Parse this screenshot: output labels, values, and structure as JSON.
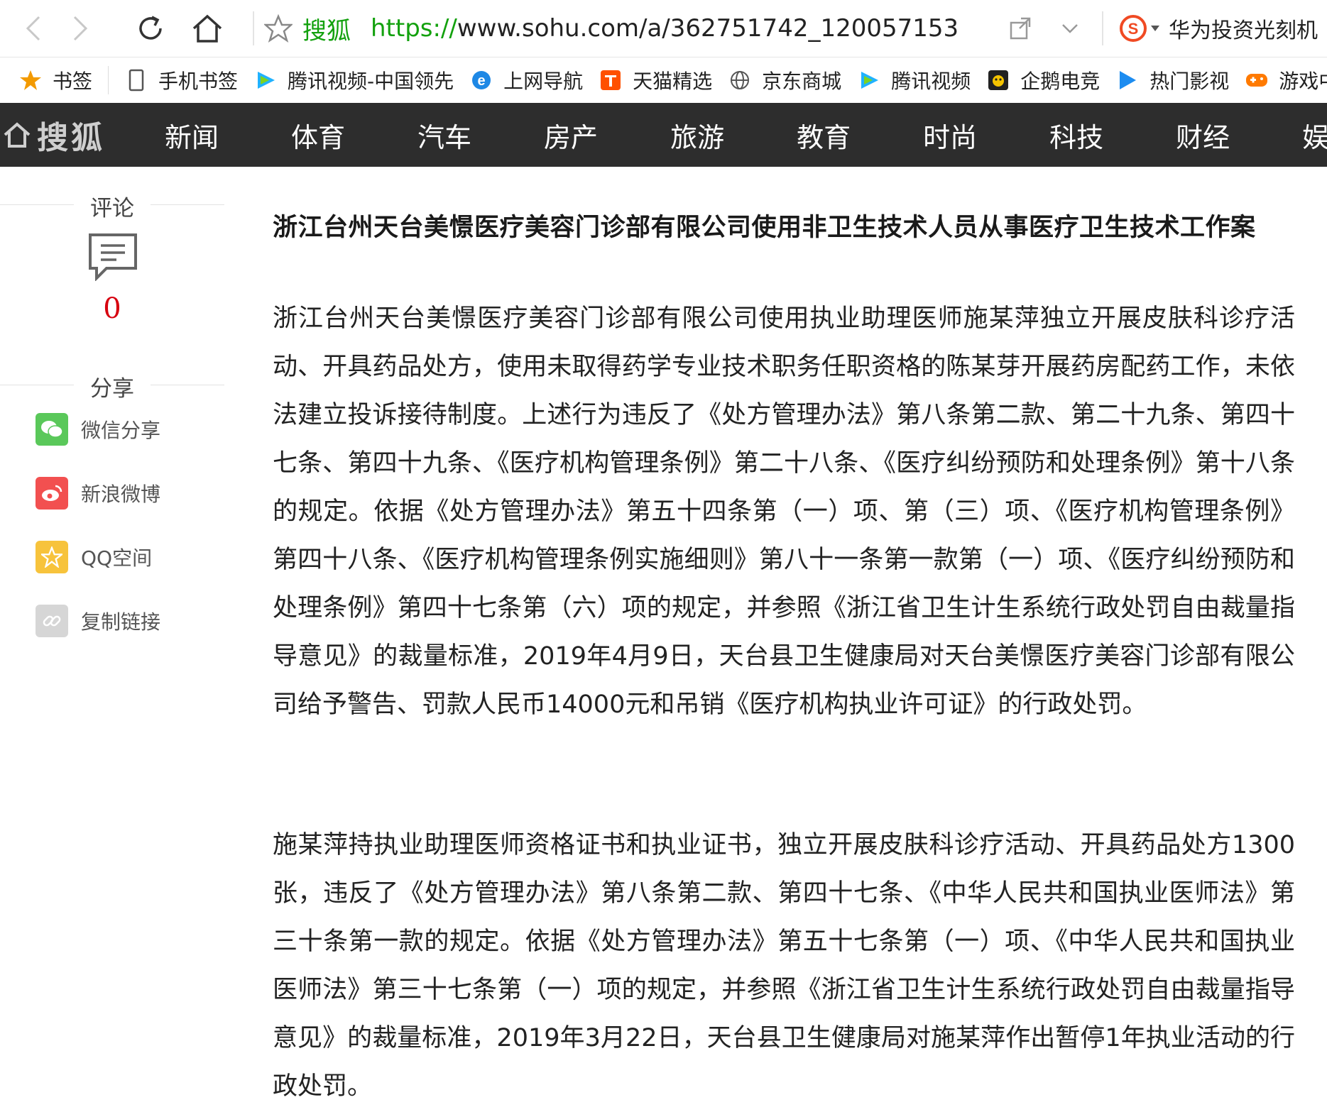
{
  "browser": {
    "address": {
      "site_label": "搜狐",
      "url_protocol": "https://",
      "url_rest": "www.sohu.com/a/362751742_120057153"
    },
    "search_text": "华为投资光刻机"
  },
  "bookmarks": [
    {
      "label": "书签",
      "icon": "star-icon"
    },
    {
      "label": "手机书签",
      "icon": "phone-icon"
    },
    {
      "label": "腾讯视频-中国领先",
      "icon": "tencent-video-icon"
    },
    {
      "label": "上网导航",
      "icon": "ie-icon"
    },
    {
      "label": "天猫精选",
      "icon": "tmall-icon"
    },
    {
      "label": "京东商城",
      "icon": "globe-icon"
    },
    {
      "label": "腾讯视频",
      "icon": "tencent-video-icon"
    },
    {
      "label": "企鹅电竞",
      "icon": "penguin-icon"
    },
    {
      "label": "热门影视",
      "icon": "play-icon"
    },
    {
      "label": "游戏中",
      "icon": "gamepad-icon"
    }
  ],
  "channel_nav": {
    "logo": "搜狐",
    "items": [
      "新闻",
      "体育",
      "汽车",
      "房产",
      "旅游",
      "教育",
      "时尚",
      "科技",
      "财经",
      "娱"
    ]
  },
  "sidebar": {
    "comment_label": "评论",
    "comment_count": "0",
    "share_label": "分享",
    "share_items": [
      {
        "label": "微信分享",
        "color": "#5ac85a"
      },
      {
        "label": "新浪微博",
        "color": "#f25050"
      },
      {
        "label": "QQ空间",
        "color": "#f7c33c"
      },
      {
        "label": "复制链接",
        "color": "#d6d6d6"
      }
    ]
  },
  "article": {
    "title": "浙江台州天台美憬医疗美容门诊部有限公司使用非卫生技术人员从事医疗卫生技术工作案",
    "paragraphs": [
      "浙江台州天台美憬医疗美容门诊部有限公司使用执业助理医师施某萍独立开展皮肤科诊疗活动、开具药品处方，使用未取得药学专业技术职务任职资格的陈某芽开展药房配药工作，未依法建立投诉接待制度。上述行为违反了《处方管理办法》第八条第二款、第二十九条、第四十七条、第四十九条、《医疗机构管理条例》第二十八条、《医疗纠纷预防和处理条例》第十八条的规定。依据《处方管理办法》第五十四条第（一）项、第（三）项、《医疗机构管理条例》第四十八条、《医疗机构管理条例实施细则》第八十一条第一款第（一）项、《医疗纠纷预防和处理条例》第四十七条第（六）项的规定，并参照《浙江省卫生计生系统行政处罚自由裁量指导意见》的裁量标准，2019年4月9日，天台县卫生健康局对天台美憬医疗美容门诊部有限公司给予警告、罚款人民币14000元和吊销《医疗机构执业许可证》的行政处罚。",
      "施某萍持执业助理医师资格证书和执业证书，独立开展皮肤科诊疗活动、开具药品处方1300张，违反了《处方管理办法》第八条第二款、第四十七条、《中华人民共和国执业医师法》第三十条第一款的规定。依据《处方管理办法》第五十七条第（一）项、《中华人民共和国执业医师法》第三十七条第（一）项的规定，并参照《浙江省卫生计生系统行政处罚自由裁量指导意见》的裁量标准，2019年3月22日，天台县卫生健康局对施某萍作出暂停1年执业活动的行政处罚。"
    ]
  }
}
